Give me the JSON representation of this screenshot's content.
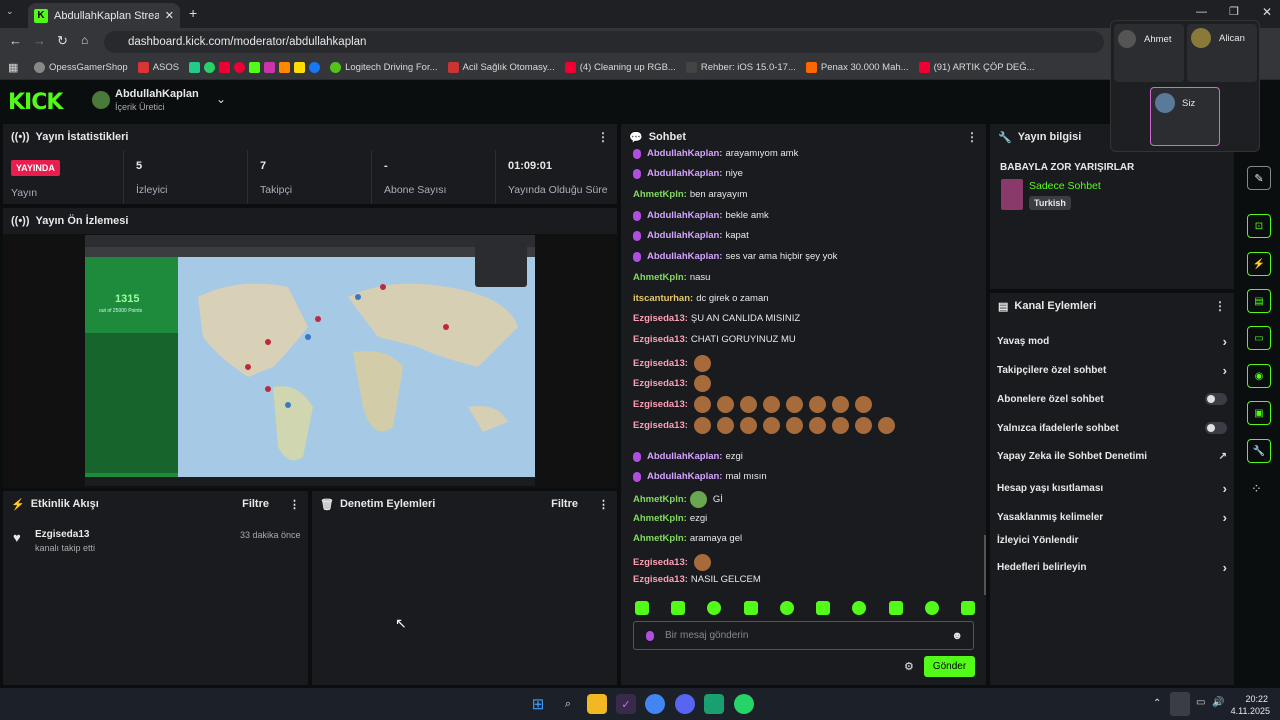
{
  "browser": {
    "tab_title": "AbdullahKaplan Stream - Kick D",
    "url": "dashboard.kick.com/moderator/abdullahkaplan",
    "bookmarks": [
      "OpessGamerShop",
      "ASOS",
      "Logitech Driving For...",
      "Acil Sağlık Otomasy...",
      "(4) Cleaning up RGB...",
      "Rehber: iOS 15.0-17...",
      "Penax 30.000 Mah...",
      "(91) ARTIK ÇÖP DEĞ..."
    ]
  },
  "header": {
    "logo": "KICK",
    "channel_name": "AbdullahKaplan",
    "channel_role": "İçerik Üretici"
  },
  "stats_panel": {
    "title": "Yayın İstatistikleri",
    "live_badge": "YAYINDA",
    "live_label": "Yayın",
    "viewers_value": "5",
    "viewers_label": "İzleyici",
    "followers_value": "7",
    "followers_label": "Takipçi",
    "subs_value": "-",
    "subs_label": "Abone Sayısı",
    "uptime_value": "01:09:01",
    "uptime_label": "Yayında Olduğu Süre"
  },
  "preview_panel": {
    "title": "Yayın Ön İzlemesi",
    "score": "1315",
    "score_sub": "out of 25000 Points"
  },
  "activity_panel": {
    "title": "Etkinlik Akışı",
    "filter": "Filtre",
    "user": "Ezgiseda13",
    "action": "kanalı takip etti",
    "time": "33 dakika önce"
  },
  "moderation_panel": {
    "title": "Denetim Eylemleri",
    "filter": "Filtre"
  },
  "chat": {
    "title": "Sohbet",
    "messages": [
      {
        "user": "AbdullahKaplan:",
        "text": "arayamıyom amk"
      },
      {
        "user": "AbdullahKaplan:",
        "text": "niye"
      },
      {
        "user": "AhmetKpln:",
        "text": "ben arayayım"
      },
      {
        "user": "AbdullahKaplan:",
        "text": "bekle amk"
      },
      {
        "user": "AbdullahKaplan:",
        "text": "kapat"
      },
      {
        "user": "AbdullahKaplan:",
        "text": "ses var ama hiçbir şey yok"
      },
      {
        "user": "AhmetKpln:",
        "text": "nasu"
      },
      {
        "user": "itscanturhan:",
        "text": "dc girek o zaman"
      },
      {
        "user": "Ezgiseda13:",
        "text": "ŞU AN CANLIDA MISINIZ"
      },
      {
        "user": "Ezgiseda13:",
        "text": "CHATI GORUYINUZ MU"
      },
      {
        "user": "Ezgiseda13:",
        "text": ""
      },
      {
        "user": "Ezgiseda13:",
        "text": ""
      },
      {
        "user": "Ezgiseda13:",
        "text": ""
      },
      {
        "user": "Ezgiseda13:",
        "text": ""
      },
      {
        "user": "AbdullahKaplan:",
        "text": "ezgi"
      },
      {
        "user": "AbdullahKaplan:",
        "text": "mal mısın"
      },
      {
        "user": "AhmetKpln:",
        "text": "Gİ"
      },
      {
        "user": "AhmetKpln:",
        "text": "ezgi"
      },
      {
        "user": "AhmetKpln:",
        "text": "aramaya gel"
      },
      {
        "user": "Ezgiseda13:",
        "text": ""
      },
      {
        "user": "Ezgiseda13:",
        "text": "NASIL GELCEM"
      }
    ],
    "input_placeholder": "Bir mesaj gönderin",
    "send_label": "Gönder"
  },
  "info_panel": {
    "title": "Yayın bilgisi",
    "stream_title": "BABAYLA ZOR YARIŞIRLAR",
    "category": "Sadece Sohbet",
    "language": "Turkish"
  },
  "channel_actions": {
    "title": "Kanal Eylemleri",
    "rows": [
      "Yavaş mod",
      "Takipçilere özel sohbet",
      "Abonelere özel sohbet",
      "Yalnızca ifadelerle sohbet",
      "Yapay Zeka ile Sohbet Denetimi",
      "Hesap yaşı kısıtlaması",
      "Yasaklanmış kelimeler",
      "İzleyici Yönlendir",
      "Hedefleri belirleyin"
    ]
  },
  "call_overlay": {
    "user1": "Ahmet",
    "user2": "Alican",
    "self": "Siz"
  },
  "taskbar": {
    "time": "20:22",
    "date": "4.11.2025"
  },
  "colors": {
    "accent": "#53fc18",
    "live": "#e91e4e"
  }
}
